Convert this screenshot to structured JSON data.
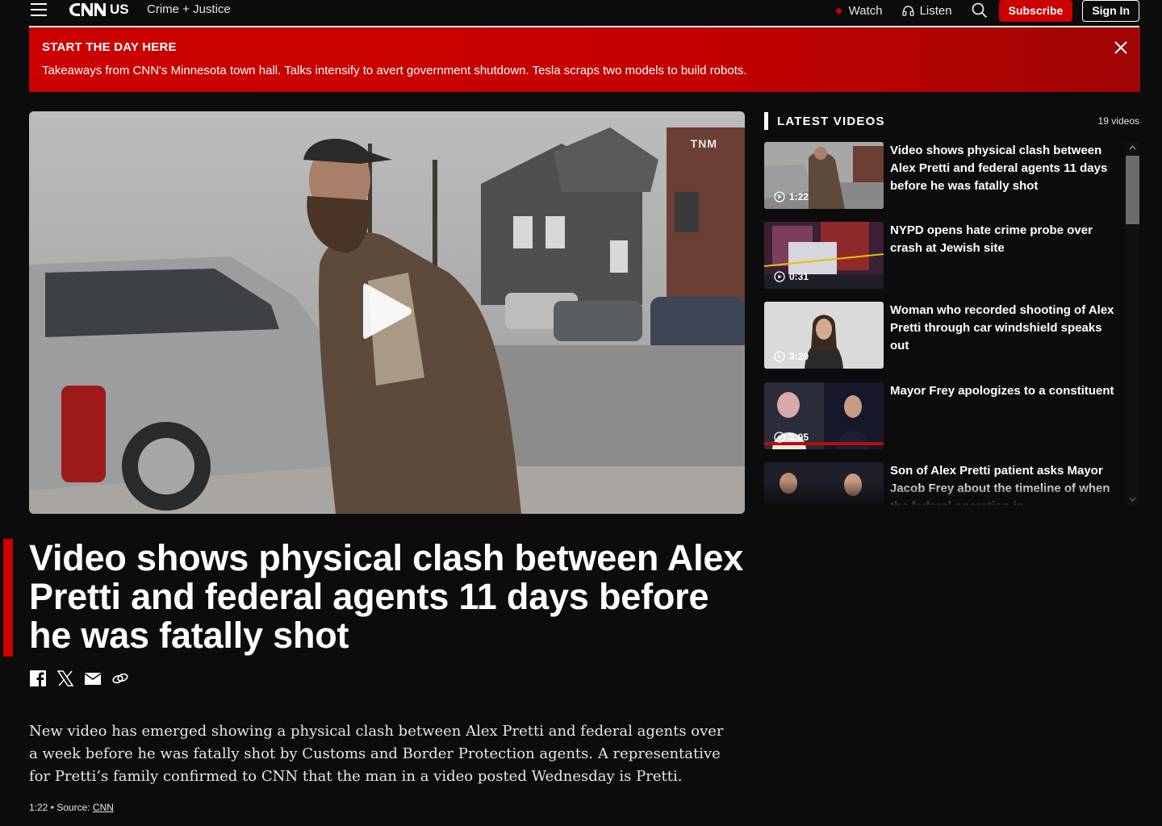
{
  "nav": {
    "edition": "US",
    "section": "Crime + Justice",
    "watch_label": "Watch",
    "listen_label": "Listen",
    "subscribe_label": "Subscribe",
    "signin_label": "Sign In",
    "icons": [
      "menu-icon",
      "cnn-logo",
      "live-dot",
      "headphones-icon",
      "search-icon"
    ]
  },
  "banner": {
    "title": "START THE DAY HERE",
    "text": "Takeaways from CNN's Minnesota town hall. Talks intensify to avert government shutdown. Tesla scraps two models to build robots.",
    "close_icon": "close-icon"
  },
  "video": {
    "watermark": "TNM",
    "play_icon": "play-icon"
  },
  "article": {
    "headline": "Video shows physical clash between Alex Pretti and federal agents 11 days before he was fatally shot",
    "share_icons": [
      "facebook-icon",
      "x-icon",
      "email-icon",
      "link-icon"
    ],
    "description": "New video has emerged showing a physical clash between Alex Pretti and federal agents over a week before he was fatally shot by Customs and Border Protection agents. A representative for Pretti’s family confirmed to CNN that the man in a video posted Wednesday is Pretti.",
    "duration": "1:22",
    "source_prefix": " • Source: ",
    "source": "CNN"
  },
  "sidebar": {
    "title": "LATEST VIDEOS",
    "count": "19 videos",
    "items": [
      {
        "title": "Video shows physical clash between Alex Pretti and federal agents 11 days before he was fatally shot",
        "duration": "1:22"
      },
      {
        "title": "NYPD opens hate crime probe over crash at Jewish site",
        "duration": "0:31"
      },
      {
        "title": "Woman who recorded shooting of Alex Pretti through car windshield speaks out",
        "duration": "3:29"
      },
      {
        "title": "Mayor Frey apologizes to a constituent",
        "duration": "3:05"
      },
      {
        "title": "Son of Alex Pretti patient asks Mayor Jacob Frey about the timeline of when the federal operation in",
        "duration": ""
      }
    ]
  },
  "colors": {
    "accent": "#cc0000",
    "background": "#0c0c0c",
    "text": "#ffffff"
  }
}
